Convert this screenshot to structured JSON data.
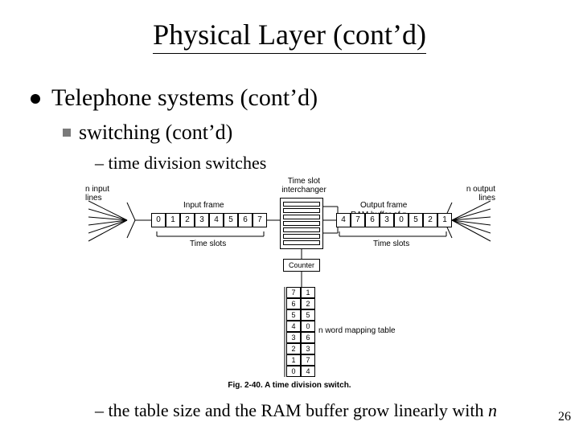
{
  "title": "Physical Layer (cont’d)",
  "bullets": {
    "level1": "Telephone systems (cont’d)",
    "level2": "switching (cont’d)",
    "level3a_prefix": "– ",
    "level3a": "time division switches",
    "level3b_prefix": "– ",
    "level3b_part1": "the table size and the  RAM buffer grow linearly with ",
    "level3b_italic": "n"
  },
  "figure": {
    "labels": {
      "n_input": "n input\nlines",
      "n_output": "n output\nlines",
      "input_frame": "Input frame",
      "output_frame": "Output frame",
      "time_slots_left": "Time slots",
      "time_slots_right": "Time slots",
      "tsi": "Time slot\ninterchanger",
      "counter": "Counter",
      "ram": "RAM buffer of\nn k-bit words",
      "mapping": "n word mapping table"
    },
    "input_slots": [
      "0",
      "1",
      "2",
      "3",
      "4",
      "5",
      "6",
      "7"
    ],
    "output_slots": [
      "4",
      "7",
      "6",
      "3",
      "0",
      "5",
      "2",
      "1"
    ],
    "mapping_table": {
      "left": [
        "7",
        "6",
        "5",
        "4",
        "3",
        "2",
        "1",
        "0"
      ],
      "right": [
        "1",
        "2",
        "5",
        "0",
        "6",
        "3",
        "7",
        "4"
      ]
    },
    "caption": "Fig. 2-40.  A time division switch."
  },
  "page_number": "26"
}
